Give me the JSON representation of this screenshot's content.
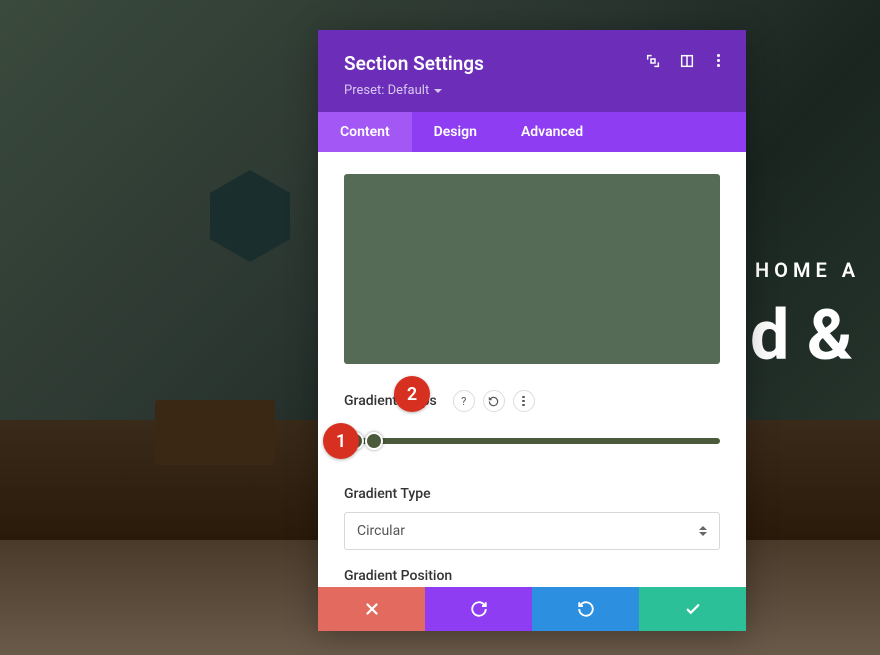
{
  "background": {
    "hero_small": "HOME A",
    "hero_large": "d &"
  },
  "panel": {
    "title": "Section Settings",
    "preset": "Preset: Default",
    "tabs": [
      {
        "label": "Content",
        "active": true
      },
      {
        "label": "Design",
        "active": false
      },
      {
        "label": "Advanced",
        "active": false
      }
    ],
    "gradient_stops": {
      "label": "Gradient Stops",
      "preview_color": "#556b55",
      "handles": [
        3,
        8
      ]
    },
    "gradient_type": {
      "label": "Gradient Type",
      "value": "Circular"
    },
    "gradient_position": {
      "label": "Gradient Position"
    }
  },
  "annotations": [
    {
      "n": "1"
    },
    {
      "n": "2"
    }
  ]
}
